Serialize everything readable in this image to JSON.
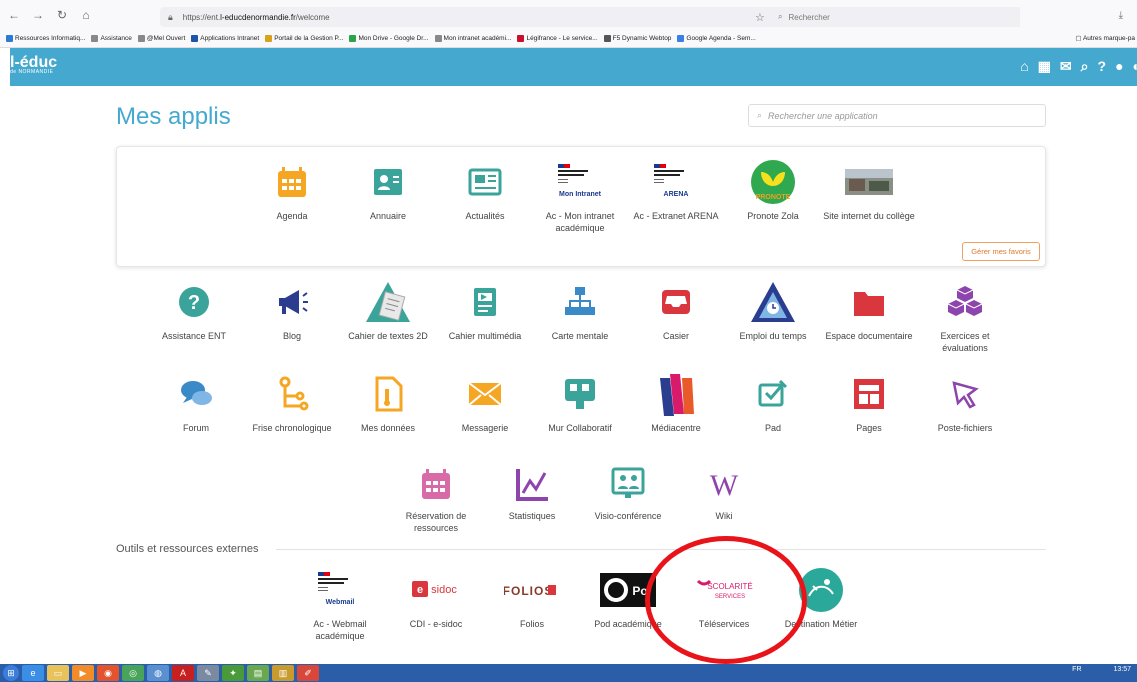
{
  "browser": {
    "url_prefix": "https://ent.",
    "url_domain": "l-educdenormandie.fr",
    "url_path": "/welcome",
    "search_placeholder": "Rechercher",
    "bookmarks": [
      {
        "label": "Ressources Informatiq...",
        "color": "#2b7bd4"
      },
      {
        "label": "Assistance",
        "color": "#888888"
      },
      {
        "label": "@Mel Ouvert",
        "color": "#888888"
      },
      {
        "label": "Applications Intranet",
        "color": "#1a55a8"
      },
      {
        "label": "Portail de la Gestion P...",
        "color": "#d9a21b"
      },
      {
        "label": "Mon Drive - Google Dr...",
        "color": "#2ca24a"
      },
      {
        "label": "Mon intranet académi...",
        "color": "#888888"
      },
      {
        "label": "Légifrance - Le service...",
        "color": "#c8102e"
      },
      {
        "label": "F5 Dynamic Webtop",
        "color": "#555555"
      },
      {
        "label": "Google Agenda - Sem...",
        "color": "#3a7ee8"
      }
    ],
    "other_bookmarks": "Autres marque-pa"
  },
  "header": {
    "logo_text": "l-éduc",
    "logo_sub": "de NORMANDIE"
  },
  "page": {
    "title": "Mes applis",
    "search_placeholder": "Rechercher une application",
    "manage_favorites": "Gérer mes favoris",
    "external_section": "Outils et ressources externes"
  },
  "favorites": [
    {
      "label": "Agenda",
      "icon": "calendar-icon"
    },
    {
      "label": "Annuaire",
      "icon": "contact-card-icon"
    },
    {
      "label": "Actualités",
      "icon": "newspaper-icon"
    },
    {
      "label": "Ac - Mon intranet académique",
      "icon": "academie-logo-icon",
      "logo_text": "Mon Intranet"
    },
    {
      "label": "Ac - Extranet ARENA",
      "icon": "academie-logo-icon",
      "logo_text": "ARENA"
    },
    {
      "label": "Pronote Zola",
      "icon": "pronote-icon"
    },
    {
      "label": "Site internet du collège",
      "icon": "website-thumbnail-icon"
    }
  ],
  "apps_row1": [
    {
      "label": "Assistance ENT",
      "icon": "help-icon"
    },
    {
      "label": "Blog",
      "icon": "megaphone-icon"
    },
    {
      "label": "Cahier de textes 2D",
      "icon": "textbook-icon"
    },
    {
      "label": "Cahier multimédia",
      "icon": "multimedia-notebook-icon"
    },
    {
      "label": "Carte mentale",
      "icon": "mindmap-icon"
    },
    {
      "label": "Casier",
      "icon": "inbox-tray-icon"
    },
    {
      "label": "Emploi du temps",
      "icon": "timetable-icon"
    },
    {
      "label": "Espace documentaire",
      "icon": "folder-icon"
    },
    {
      "label": "Exercices et évaluations",
      "icon": "cubes-icon"
    }
  ],
  "apps_row2": [
    {
      "label": "Forum",
      "icon": "chat-bubbles-icon"
    },
    {
      "label": "Frise chronologique",
      "icon": "timeline-icon"
    },
    {
      "label": "Mes données",
      "icon": "document-icon"
    },
    {
      "label": "Messagerie",
      "icon": "envelope-icon"
    },
    {
      "label": "Mur Collaboratif",
      "icon": "collab-wall-icon"
    },
    {
      "label": "Médiacentre",
      "icon": "mediacentre-icon"
    },
    {
      "label": "Pad",
      "icon": "pad-icon"
    },
    {
      "label": "Pages",
      "icon": "pages-icon"
    },
    {
      "label": "Poste-fichiers",
      "icon": "file-drop-icon"
    }
  ],
  "apps_row3": [
    {
      "label": "Réservation de ressources",
      "icon": "reservation-calendar-icon"
    },
    {
      "label": "Statistiques",
      "icon": "stats-chart-icon"
    },
    {
      "label": "Visio-conférence",
      "icon": "videoconference-icon"
    },
    {
      "label": "Wiki",
      "icon": "wiki-icon",
      "glyph": "W"
    }
  ],
  "external": [
    {
      "label": "Ac - Webmail académique",
      "icon": "academie-logo-icon",
      "logo_text": "Webmail"
    },
    {
      "label": "CDI - e-sidoc",
      "icon": "esidoc-icon",
      "logo_text": "e-sidoc"
    },
    {
      "label": "Folios",
      "icon": "folios-icon",
      "logo_text": "FOLIOS"
    },
    {
      "label": "Pod académique",
      "icon": "pod-icon",
      "logo_text": "Po"
    },
    {
      "label": "Téléservices",
      "icon": "scolarite-services-icon",
      "logo_text": "SCOLARITÉ SERVICES"
    },
    {
      "label": "Destination Métier",
      "icon": "destination-metier-icon"
    }
  ],
  "taskbar": {
    "lang": "FR",
    "time": "13:57"
  },
  "colors": {
    "accent": "#45a9cf",
    "orange": "#f5a623",
    "teal": "#3aa39a",
    "red": "#d9363e",
    "navy": "#2a3d8f",
    "purple": "#8e44ad",
    "highlight": "#e8141a"
  }
}
